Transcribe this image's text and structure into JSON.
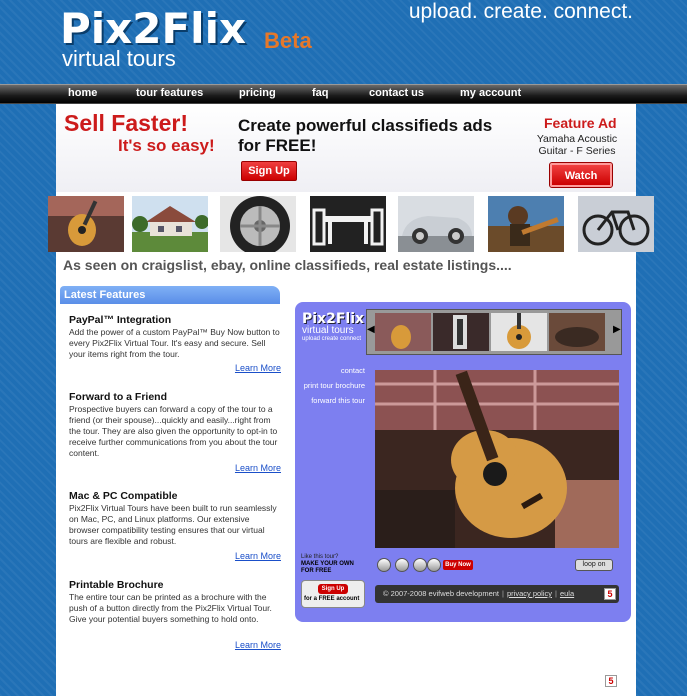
{
  "header": {
    "logo": "Pix2Flix",
    "beta": "Beta",
    "subtitle": "virtual tours",
    "tagline": "upload. create. connect."
  },
  "nav": {
    "items": [
      "home",
      "tour features",
      "pricing",
      "faq",
      "contact us",
      "my account"
    ]
  },
  "banner": {
    "sell_line1": "Sell Faster!",
    "sell_line2": "It's so easy!",
    "create_line1": "Create powerful classifieds ads",
    "create_line2": "for FREE!",
    "signup_label": "Sign Up",
    "feature_ad_title": "Feature Ad",
    "feature_ad_item": "Yamaha Acoustic Guitar - F Series",
    "watch_label": "Watch"
  },
  "seen_on": "As seen on craigslist, ebay, online classifieds, real estate listings....",
  "features": {
    "heading": "Latest Features",
    "items": [
      {
        "title": "PayPal™ Integration",
        "text": "Add the power of a custom PayPal™ Buy Now button to every Pix2Flix Virtual Tour. It's easy and secure. Sell your items right from the tour.",
        "link": "Learn More"
      },
      {
        "title": "Forward to a Friend",
        "text": "Prospective buyers can forward a copy of the tour to a friend (or their spouse)...quickly and easily...right from the tour. They are also given the opportunity to opt-in to receive further communications from you about the tour content.",
        "link": "Learn More"
      },
      {
        "title": "Mac & PC Compatible",
        "text": "Pix2Flix Virtual Tours have been built to run seamlessly on Mac, PC, and Linux platforms. Our extensive browser compatibility testing ensures that our virtual tours are flexible and robust.",
        "link": "Learn More"
      },
      {
        "title": "Printable Brochure",
        "text": "The entire tour can be printed as a brochure with the push of a button directly from the Pix2Flix Virtual Tour. Give your potential buyers something to hold onto.",
        "link": "Learn More"
      }
    ]
  },
  "player": {
    "logo": "Pix2Flix",
    "subtitle": "virtual tours",
    "tagline": "upload  create  connect",
    "links": [
      "contact",
      "print tour brochure",
      "forward this tour"
    ],
    "buy_now": "Buy Now",
    "loop": "loop on",
    "promo_line1": "Like this tour?",
    "promo_line2": "MAKE YOUR OWN FOR FREE",
    "promo_signup": "Sign Up",
    "promo_free": "for a FREE account",
    "copyright": "© 2007-2008 evifweb development",
    "privacy": "privacy policy",
    "eula": "eula",
    "badge": "5"
  },
  "page_badge": "5",
  "colors": {
    "background": "#1f6fb5",
    "accent_red": "#cc1b1b",
    "player_purple": "#7d7ff0",
    "beta_orange": "#e5782a"
  }
}
